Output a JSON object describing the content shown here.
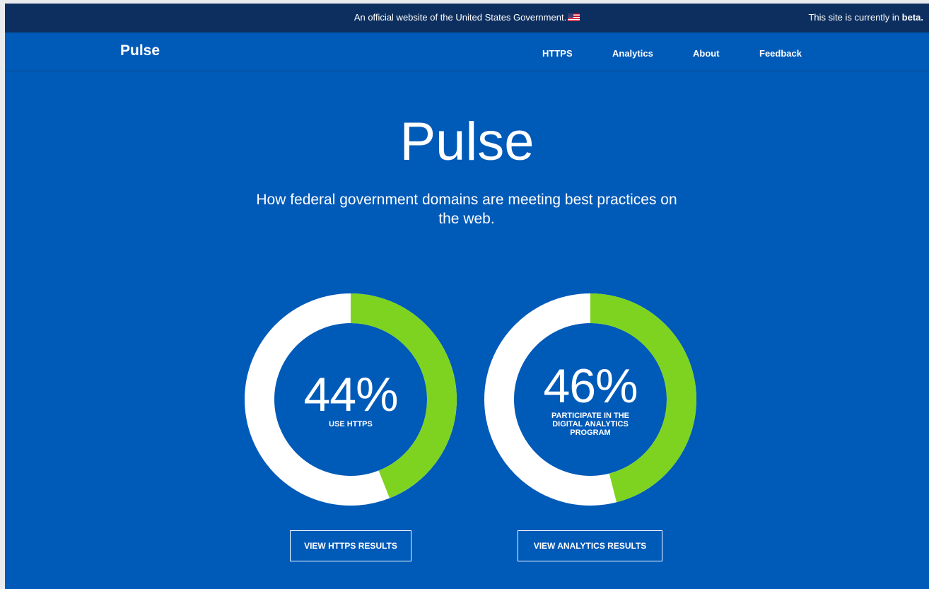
{
  "gov_banner": {
    "text": "An official website of the United States Government.",
    "beta_prefix": "This site is currently in",
    "beta_word": "beta."
  },
  "nav": {
    "brand": "Pulse",
    "links": [
      "HTTPS",
      "Analytics",
      "About",
      "Feedback"
    ]
  },
  "hero": {
    "title": "Pulse",
    "subtitle": "How federal government domains are meeting best practices on the web."
  },
  "stats": [
    {
      "percent_label": "44%",
      "value": 0.44,
      "label": "USE HTTPS",
      "button": "VIEW HTTPS RESULTS"
    },
    {
      "percent_label": "46%",
      "value": 0.46,
      "label": "PARTICIPATE IN THE DIGITAL ANALYTICS PROGRAM",
      "button": "VIEW ANALYTICS RESULTS"
    }
  ],
  "colors": {
    "page_bg": "#005ab8",
    "banner_bg": "#0d2f5f",
    "accent_green": "#7ed321",
    "ring_track": "#ffffff"
  }
}
